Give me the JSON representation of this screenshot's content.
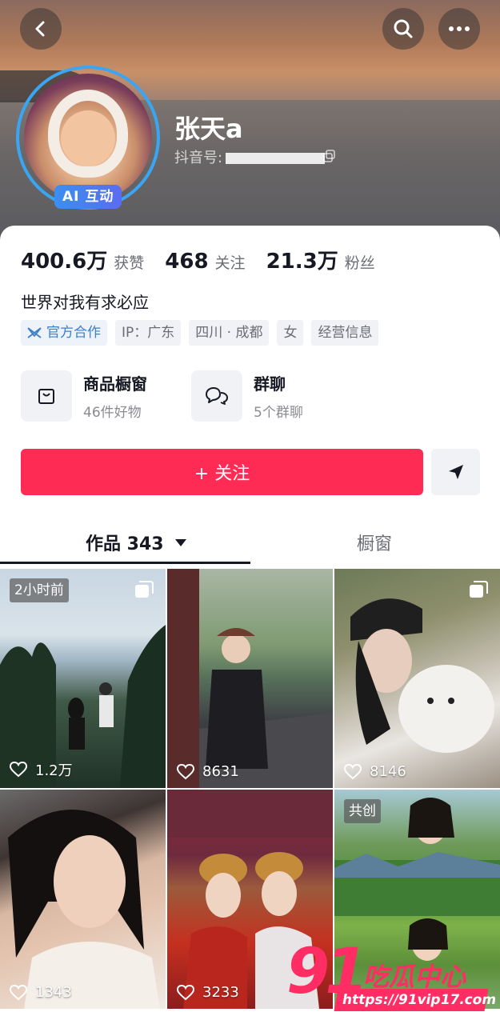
{
  "profile": {
    "name": "张天a",
    "douyin_id_label": "抖音号:",
    "ai_badge": "AI 互动",
    "bio": "世界对我有求必应"
  },
  "stats": [
    {
      "value": "400.6万",
      "label": "获赞"
    },
    {
      "value": "468",
      "label": "关注"
    },
    {
      "value": "21.3万",
      "label": "粉丝"
    }
  ],
  "tags": {
    "official": "官方合作",
    "ip": "IP：广东",
    "location": "四川 · 成都",
    "gender": "女",
    "business": "经营信息"
  },
  "shortcuts": [
    {
      "title": "商品橱窗",
      "subtitle": "46件好物",
      "icon": "shopping-bag-icon"
    },
    {
      "title": "群聊",
      "subtitle": "5个群聊",
      "icon": "chat-bubbles-icon"
    }
  ],
  "actions": {
    "follow_label": "+ 关注"
  },
  "tabs": {
    "works_label": "作品 343",
    "shop_label": "橱窗"
  },
  "grid": [
    {
      "likes": "1.2万",
      "badge": "2小时前",
      "multi": true
    },
    {
      "likes": "8631"
    },
    {
      "likes": "8146",
      "multi": true
    },
    {
      "likes": "1343"
    },
    {
      "likes": "3233"
    },
    {
      "badge": "共创"
    }
  ],
  "watermark": {
    "number": "91",
    "text": "吃瓜中心",
    "url": "https://91vip17.com"
  },
  "colors": {
    "accent": "#fe2c55",
    "avatar_ring": "#3aa6f3",
    "official_tag": "#3e7fc9"
  }
}
